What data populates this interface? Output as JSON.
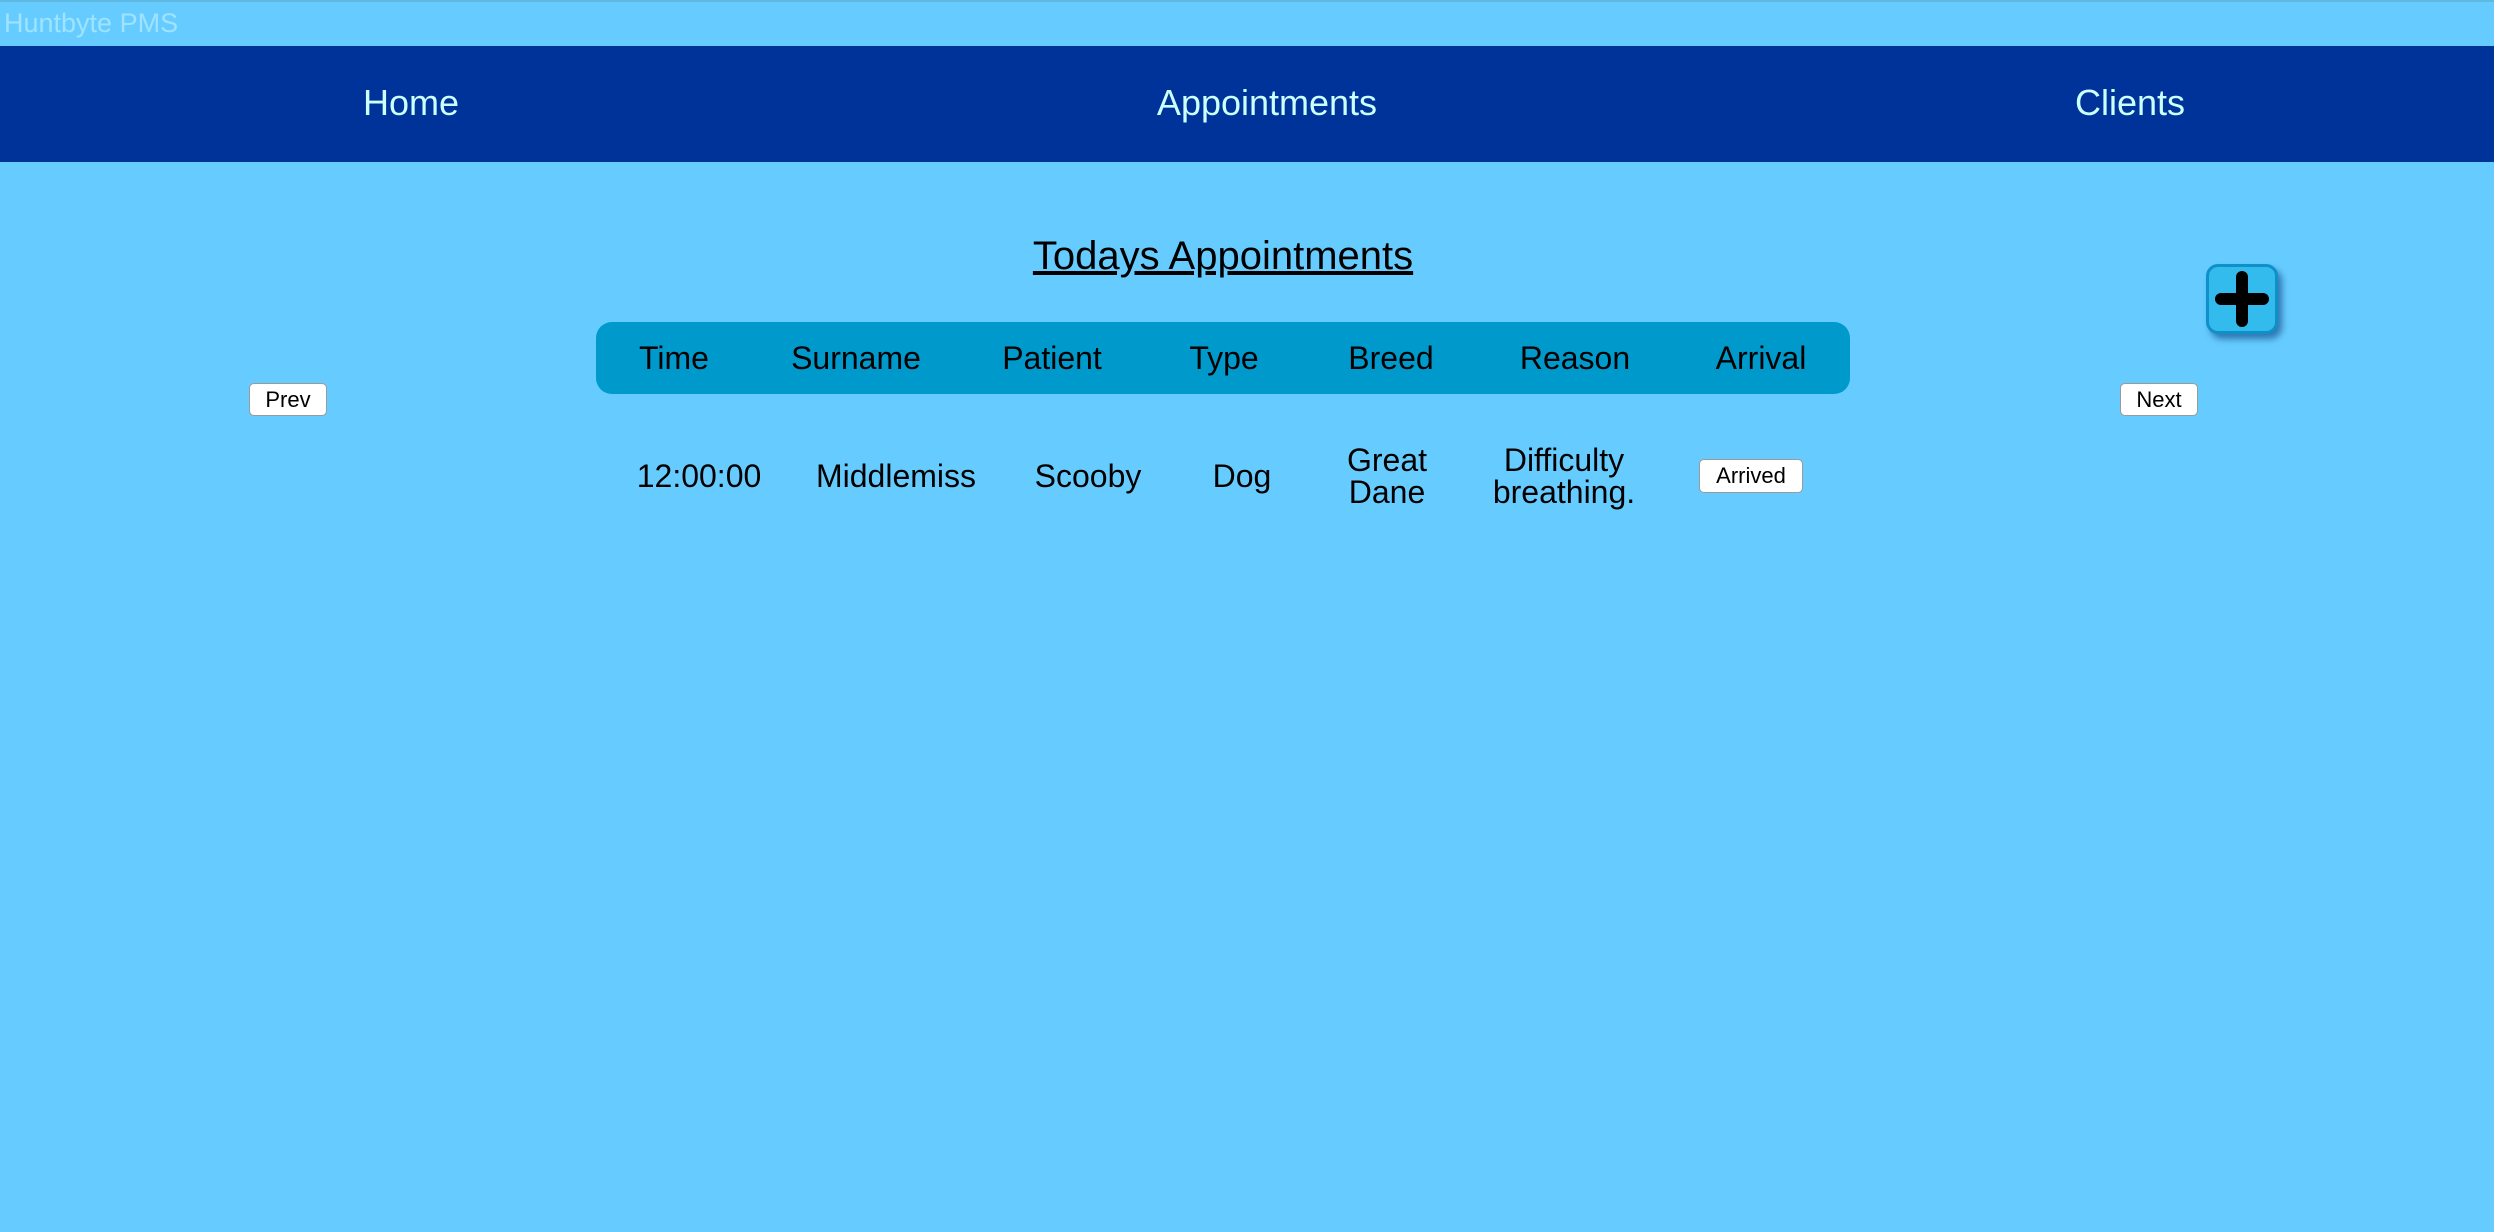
{
  "app": {
    "title": "Huntbyte PMS"
  },
  "nav": {
    "home": "Home",
    "appointments": "Appointments",
    "clients": "Clients"
  },
  "page": {
    "title": "Todays Appointments"
  },
  "pager": {
    "prev": "Prev",
    "next": "Next"
  },
  "add_button": {
    "icon": "plus-icon"
  },
  "table": {
    "headers": {
      "time": "Time",
      "surname": "Surname",
      "patient": "Patient",
      "type": "Type",
      "breed": "Breed",
      "reason": "Reason",
      "arrival": "Arrival"
    },
    "rows": [
      {
        "time": "12:00:00",
        "surname": "Middlemiss",
        "patient": "Scooby",
        "type": "Dog",
        "breed": "Great Dane",
        "reason": "Difficulty breathing.",
        "arrival": "Arrived"
      }
    ]
  },
  "colors": {
    "background": "#66CCFF",
    "navbar": "#003399",
    "nav_text": "#CCFFFF",
    "table_header": "#0099CC",
    "app_title": "#9EE3FF"
  }
}
